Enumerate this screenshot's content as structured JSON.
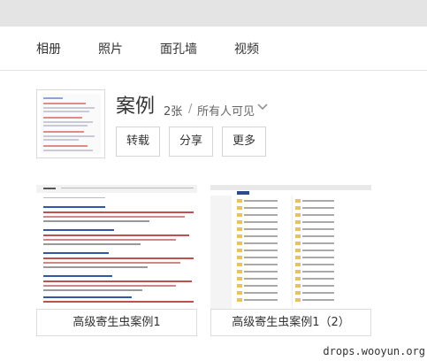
{
  "nav": {
    "tabs": [
      {
        "label": "相册"
      },
      {
        "label": "照片"
      },
      {
        "label": "面孔墙"
      },
      {
        "label": "视频"
      }
    ]
  },
  "album": {
    "title": "案例",
    "count": "2张",
    "separator": "/",
    "privacy": "所有人可见",
    "buttons": {
      "repost": "转载",
      "share": "分享",
      "more": "更多"
    }
  },
  "photos": [
    {
      "caption": "高级寄生虫案例1"
    },
    {
      "caption": "高级寄生虫案例1（2）"
    }
  ],
  "watermark": "drops.wooyun.org",
  "colors": {
    "topbar": "#e4e4e4",
    "nav_text": "#333333",
    "border": "#d4d4d4",
    "link_red": "#c0392b",
    "link_blue": "#3355aa",
    "folder": "#e6c35c"
  }
}
